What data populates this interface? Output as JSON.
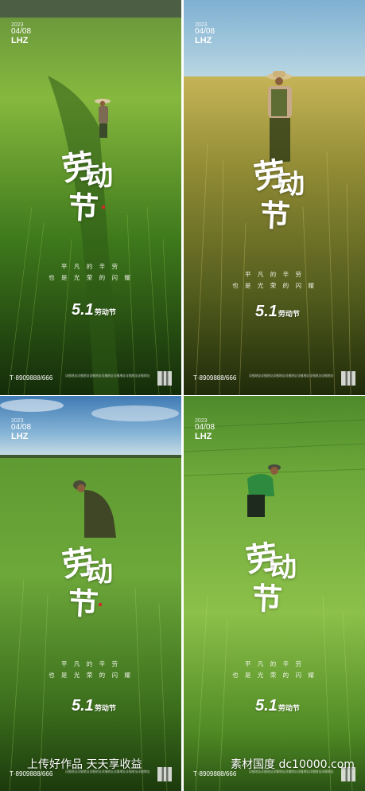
{
  "posters": [
    {
      "year": "2023",
      "monthday": "04/08",
      "code": "LHZ",
      "title_chars": [
        "劳",
        "动",
        "节"
      ],
      "slogan_line1": "平 凡 的 辛 劳",
      "slogan_line2": "也 是 光 荣 的 闪 耀",
      "logo_number": "5.1",
      "logo_text": "劳动节",
      "phone": "T·8909888/666",
      "address": "详细地址详细地址详细地址详细地址详细地址详细地址详细地址"
    },
    {
      "year": "2023",
      "monthday": "04/08",
      "code": "LHZ",
      "title_chars": [
        "劳",
        "动",
        "节"
      ],
      "slogan_line1": "平 凡 的 辛 劳",
      "slogan_line2": "也 是 光 荣 的 闪 耀",
      "logo_number": "5.1",
      "logo_text": "劳动节",
      "phone": "T·8909888/666",
      "address": "详细地址详细地址详细地址详细地址详细地址详细地址详细地址"
    },
    {
      "year": "2023",
      "monthday": "04/08",
      "code": "LHZ",
      "title_chars": [
        "劳",
        "动",
        "节"
      ],
      "slogan_line1": "平 凡 的 辛 劳",
      "slogan_line2": "也 是 光 荣 的 闪 耀",
      "logo_number": "5.1",
      "logo_text": "劳动节",
      "phone": "T·8909888/666",
      "address": "详细地址详细地址详细地址详细地址详细地址详细地址详细地址"
    },
    {
      "year": "2023",
      "monthday": "04/08",
      "code": "LHZ",
      "title_chars": [
        "劳",
        "动",
        "节"
      ],
      "slogan_line1": "平 凡 的 辛 劳",
      "slogan_line2": "也 是 光 荣 的 闪 耀",
      "logo_number": "5.1",
      "logo_text": "劳动节",
      "phone": "T·8909888/666",
      "address": "详细地址详细地址详细地址详细地址详细地址详细地址详细地址"
    }
  ],
  "watermark": {
    "left_text": "上传好作品  天天享收益",
    "right_text": "素材国度  dc10000.com"
  },
  "colors": {
    "grass_dark": "#1f3d12",
    "grass_mid": "#4a8a22",
    "grass_light": "#8cc04a",
    "wheat": "#b8a648",
    "sky_blue": "#9cc6de",
    "accent_red": "#d52a2a"
  }
}
